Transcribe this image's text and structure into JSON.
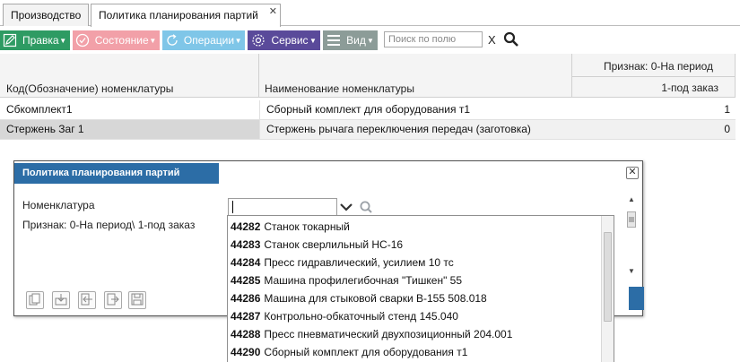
{
  "tabs": [
    {
      "label": "Производство"
    },
    {
      "label": "Политика планирования партий",
      "close": "✕"
    }
  ],
  "toolbar": {
    "edit": {
      "label": "Правка",
      "icon": "edit-icon"
    },
    "state": {
      "label": "Состояние",
      "icon": "status-icon"
    },
    "operations": {
      "label": "Операции",
      "icon": "refresh-icon"
    },
    "service": {
      "label": "Сервис",
      "icon": "gear-icon"
    },
    "view": {
      "label": "Вид",
      "icon": "list-view-icon"
    },
    "search_placeholder": "Поиск по полю",
    "clear": "X"
  },
  "colors": {
    "edit": "#2e9b63",
    "state": "#f2a0a8",
    "operations": "#7fc6e8",
    "service": "#5a4a9a",
    "view": "#8c9c98",
    "dialog_title": "#2c6da6",
    "selected_row": "#d7d7d7"
  },
  "grid": {
    "header_group": "Признак: 0-На период",
    "columns": [
      "Код(Обозначение) номенклатуры",
      "Наименование номенклатуры",
      "1-под заказ"
    ],
    "rows": [
      {
        "code": "Сбкомплект1",
        "name": "Сборный комплект для оборудования т1",
        "flag": "1"
      },
      {
        "code": "Стержень Заг 1",
        "name": "Стержень рычага переключения передач (заготовка)",
        "flag": "0"
      }
    ]
  },
  "dialog": {
    "title": "Политика планирования партий",
    "close": "✕",
    "nomenclature_label": "Номенклатура",
    "sign_label": "Признак: 0-На период\\ 1-под заказ",
    "combo_value": ""
  },
  "dropdown": {
    "items": [
      {
        "code": "44282",
        "name": "Станок токарный"
      },
      {
        "code": "44283",
        "name": "Станок сверлильный НС-16"
      },
      {
        "code": "44284",
        "name": "Пресс гидравлический, усилием 10 тс"
      },
      {
        "code": "44285",
        "name": "Машина профилегибочная \"Тишкен\" 55"
      },
      {
        "code": "44286",
        "name": "Машина для стыковой сварки В-155 508.018"
      },
      {
        "code": "44287",
        "name": "Контрольно-обкаточный стенд 145.040"
      },
      {
        "code": "44288",
        "name": "Пресс пневматический двухпозиционный 204.001"
      },
      {
        "code": "44290",
        "name": "Сборный комплект для оборудования т1"
      }
    ]
  }
}
